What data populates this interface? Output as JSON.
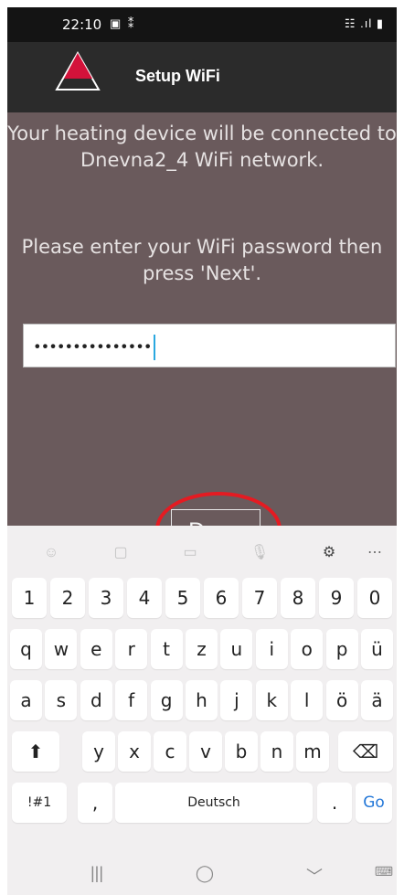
{
  "status_bar": {
    "time": "22:10",
    "left_icons": "▣ ⁑",
    "right_icons": "☷ .ıl ▮"
  },
  "app_bar": {
    "title": "Setup WiFi",
    "logo_color": "#d3123a"
  },
  "content": {
    "message_1": "Your heating device will be connected to Dnevna2_4 WiFi network.",
    "message_2": "Please enter your WiFi password then press 'Next'.",
    "password_value": "•••••••••••••••",
    "done_label": "Done"
  },
  "colors": {
    "content_bg": "#6a5a5c",
    "highlight": "#e41b22",
    "go_key": "#2478d8"
  },
  "keyboard": {
    "toolbar": [
      "emoji-icon",
      "sticker-icon",
      "gif-icon",
      "microphone-icon",
      "gear-icon",
      "more-icon"
    ],
    "row_numbers": [
      "1",
      "2",
      "3",
      "4",
      "5",
      "6",
      "7",
      "8",
      "9",
      "0"
    ],
    "row_1": [
      "q",
      "w",
      "e",
      "r",
      "t",
      "z",
      "u",
      "i",
      "o",
      "p",
      "ü"
    ],
    "row_2": [
      "a",
      "s",
      "d",
      "f",
      "g",
      "h",
      "j",
      "k",
      "l",
      "ö",
      "ä"
    ],
    "row_3": [
      "y",
      "x",
      "c",
      "v",
      "b",
      "n",
      "m"
    ],
    "row_4": {
      "symbols": "!#1",
      "comma": ",",
      "space": "Deutsch",
      "period": ".",
      "go": "Go"
    }
  },
  "nav_bar": {
    "recents": "|||",
    "home": "◯",
    "back": "﹀",
    "keyboard_icon": "⌨"
  }
}
